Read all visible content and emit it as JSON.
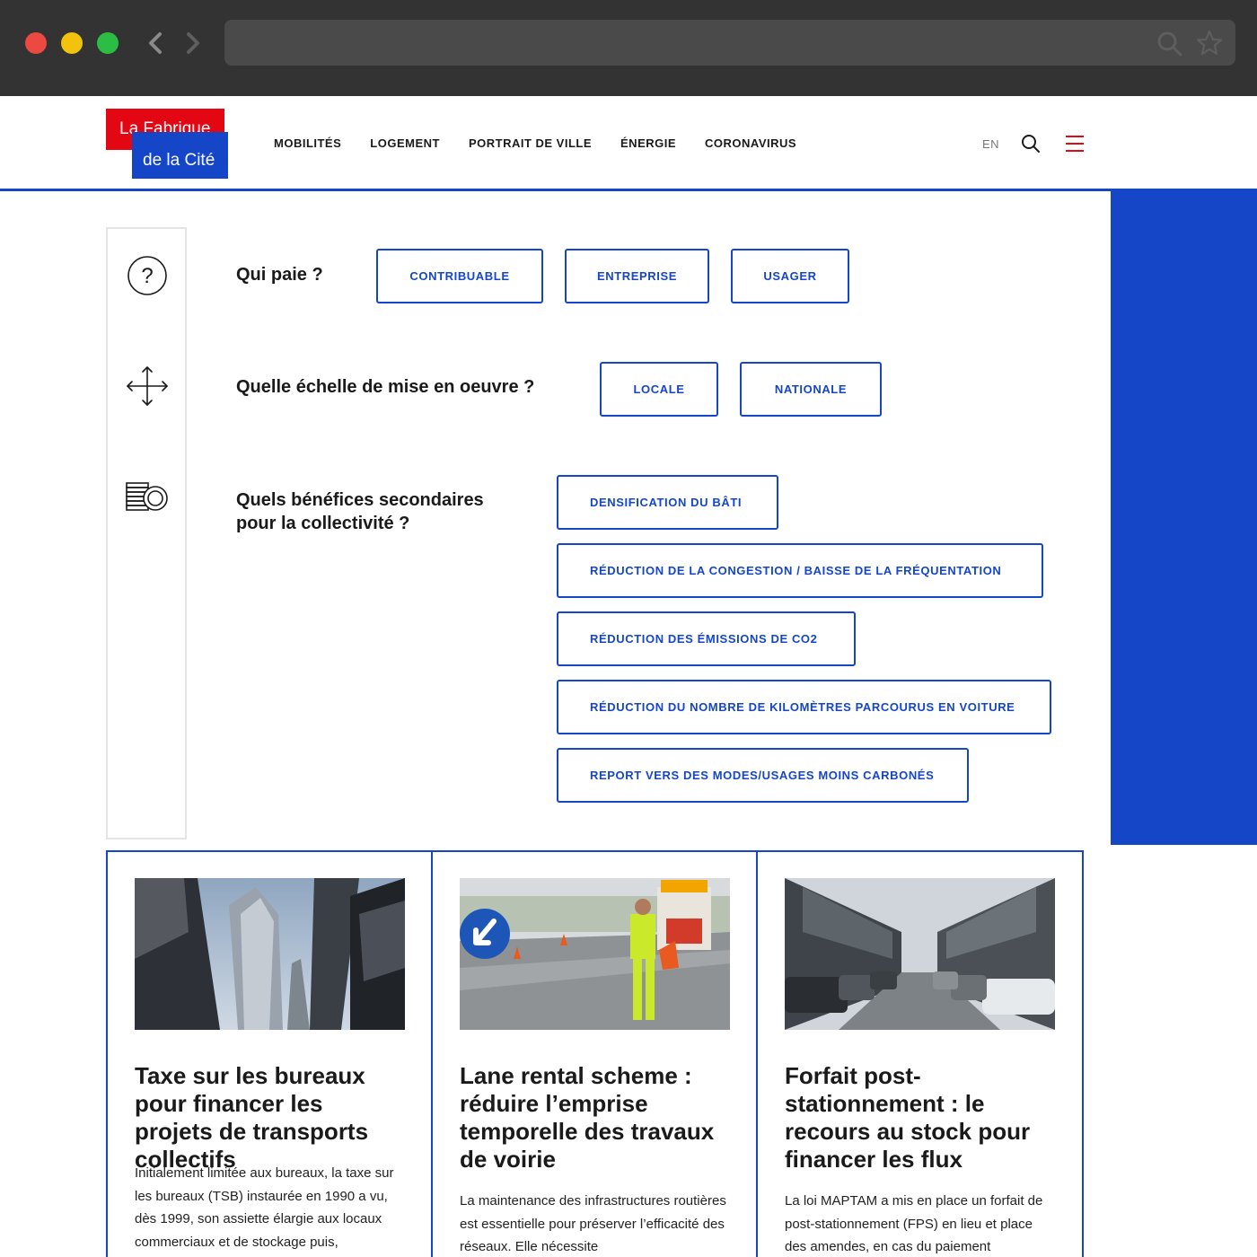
{
  "header": {
    "logo_line1": "La Fabrique",
    "logo_line2": "de la Cité",
    "nav": [
      "MOBILITÉS",
      "LOGEMENT",
      "PORTRAIT DE VILLE",
      "ÉNERGIE",
      "CORONAVIRUS"
    ],
    "lang": "EN",
    "search_icon": "search-icon",
    "menu_icon": "hamburger-menu-icon",
    "accent": "#1446c7",
    "brand_red": "#e30613"
  },
  "filters": [
    {
      "icon": "question-circle-icon",
      "label": "Qui paie ?",
      "options": [
        "CONTRIBUABLE",
        "ENTREPRISE",
        "USAGER"
      ]
    },
    {
      "icon": "move-arrows-icon",
      "label": "Quelle échelle de mise en oeuvre ?",
      "options": [
        "LOCALE",
        "NATIONALE"
      ]
    },
    {
      "icon": "coins-stack-icon",
      "label": "Quels bénéfices secondaires pour la collectivité ?",
      "options": [
        "DENSIFICATION DU BÂTI",
        "RÉDUCTION DE LA CONGESTION / BAISSE DE LA FRÉQUENTATION",
        "RÉDUCTION DES ÉMISSIONS DE CO2",
        "RÉDUCTION DU NOMBRE DE KILOMÈTRES PARCOURUS EN VOITURE",
        "REPORT VERS DES MODES/USAGES MOINS CARBONÉS"
      ]
    }
  ],
  "cards": [
    {
      "title": "Taxe sur les bureaux pour financer les projets de transports collectifs",
      "text": "Initialement limitée aux bureaux, la taxe sur les bureaux (TSB) instaurée en 1990 a vu, dès 1999, son assiette élargie aux locaux commerciaux et de stockage puis,"
    },
    {
      "title": "Lane rental scheme : réduire l’emprise temporelle des travaux de voirie",
      "text": "La maintenance des infrastructures routières est essentielle pour préserver l’efficacité des réseaux. Elle nécessite"
    },
    {
      "title": "Forfait post-stationnement : le recours au stock pour financer les flux",
      "text": "La loi MAPTAM a mis en place un forfait de post-stationnement (FPS) en lieu et place des amendes, en cas du paiement"
    }
  ]
}
